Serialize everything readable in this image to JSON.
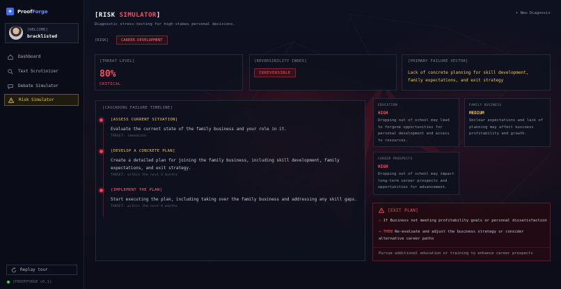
{
  "app": {
    "name_part1": "Proof",
    "name_part2": "Forge",
    "logo_glyph": "✦"
  },
  "user": {
    "welcome": "[WELCOME]",
    "name": "bracklisted"
  },
  "nav": [
    {
      "label": "Dashboard",
      "icon": "home-icon"
    },
    {
      "label": "Text Scrutinizer",
      "icon": "search-icon"
    },
    {
      "label": "Debate Simulator",
      "icon": "chat-icon"
    },
    {
      "label": "Risk Simulator",
      "icon": "warning-icon",
      "active": true
    }
  ],
  "sidebar_footer": {
    "replay": "Replay tour",
    "version": "[PROOFFORGE v0.1]"
  },
  "header": {
    "title_open": "[RISK ",
    "title_accent": "SIMULATOR",
    "title_close": "]",
    "subtitle": "Diagnostic stress-testing for high-stakes personal decisions.",
    "new_diagnosis": "+ New Diagnosis"
  },
  "risk": {
    "label": "[RISK]",
    "tag": "CAREER DEVELOPMENT"
  },
  "threat": {
    "label": "[THREAT LEVEL]",
    "value": "80%",
    "sub": "CRITICAL"
  },
  "reversibility": {
    "label": "[REVERSIBILITY INDEX]",
    "value": "IRREVERSIBLE"
  },
  "failure_vector": {
    "label": "[PRIMARY FAILURE VECTOR]",
    "text": "Lack of concrete planning for skill development, family expectations, and exit strategy"
  },
  "timeline": {
    "label": "[CASCADING FAILURE TIMELINE]",
    "items": [
      {
        "title": "[ASSESS CURRENT SITUATION]",
        "desc": "Evaluate the current state of the family business and your role in it.",
        "target": "TARGET: immediate",
        "color": "#f0c64a"
      },
      {
        "title": "[DEVELOP A CONCRETE PLAN]",
        "desc": "Create a detailed plan for joining the family business, including skill development, family expectations, and exit strategy.",
        "target": "TARGET: within the next 3 months",
        "color": "#f0c64a"
      },
      {
        "title": "[IMPLEMENT THE PLAN]",
        "desc": "Start executing the plan, including taking over the family business and addressing any skill gaps.",
        "target": "TARGET: within the next 6 months",
        "color": "#ff6a78"
      }
    ]
  },
  "impacts": [
    {
      "category": "EDUCATION",
      "level": "HIGH",
      "color": "#ff4d5e",
      "text": "Dropping out of school may lead to forgone opportunities for personal development and access to resources."
    },
    {
      "category": "FAMILY BUSINESS",
      "level": "MEDIUM",
      "color": "#f0c64a",
      "text": "Unclear expectations and lack of planning may affect business profitability and growth."
    },
    {
      "category": "CAREER PROSPECTS",
      "level": "HIGH",
      "color": "#ff4d5e",
      "text": "Dropping out of school may impact long-term career prospects and opportunities for advancement."
    }
  ],
  "exit_plan": {
    "label": "[EXIT PLAN]",
    "if_text": "If Business not meeting profitability goals or personal dissatisfaction",
    "then_kw": "THEN",
    "then_text": "Re-evaluate and adjust the business strategy or consider alternative career paths",
    "footer": "Pursue additional education or training to enhance career prospects"
  }
}
